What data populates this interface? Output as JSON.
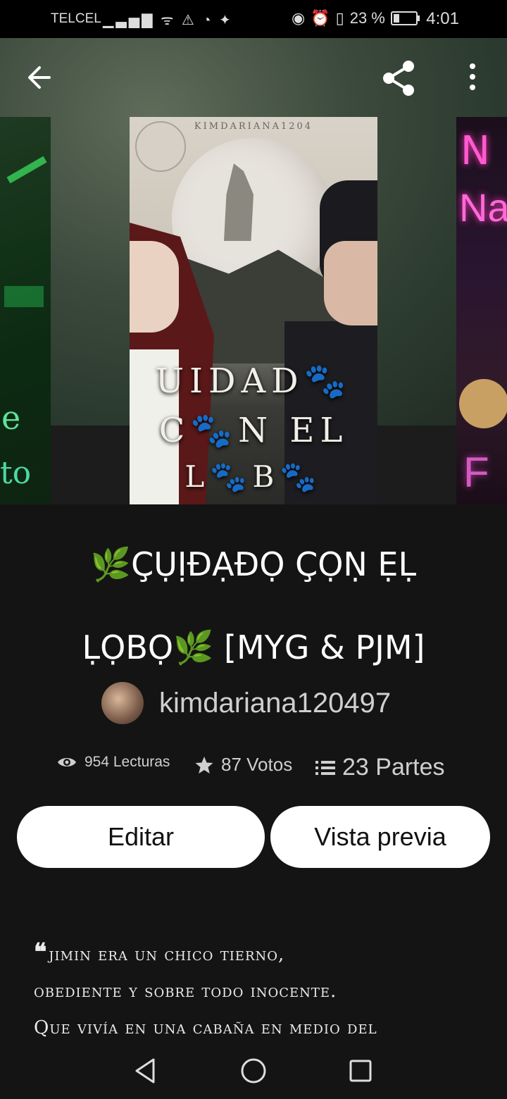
{
  "status_bar": {
    "carrier": "TELCEL",
    "battery": "23 %",
    "time": "4:01"
  },
  "story": {
    "title_line1": "🌿ÇỤỊĐẠĐỌ ÇỌṆ ẸḶ",
    "title_line2": "ḶỌBỌ🌿 [MYG & PJM]",
    "author": "kimdariana120497",
    "reads": "954 Lecturas",
    "votes": "87 Votos",
    "parts": "23 Partes",
    "description_lines": [
      "jimin era un chico tierno,",
      "obediente y sobre todo inocente.",
      "Que vivía en una cabaña en medio del"
    ]
  },
  "cover": {
    "top_text": "KIMDARIANA1204",
    "line1": "UIDAD🐾",
    "line2": "C🐾N EL",
    "line3": "L🐾B🐾"
  },
  "side_covers": {
    "left_glyph1": "e",
    "left_glyph2": "to",
    "right_neon1": "N",
    "right_neon2": "Na",
    "right_neon3": "F"
  },
  "buttons": {
    "edit": "Editar",
    "preview": "Vista previa"
  },
  "icons": {
    "back": "arrow-left-icon",
    "share": "share-icon",
    "more": "more-vertical-icon",
    "reads": "eye-icon",
    "votes": "star-icon",
    "parts": "list-icon"
  }
}
